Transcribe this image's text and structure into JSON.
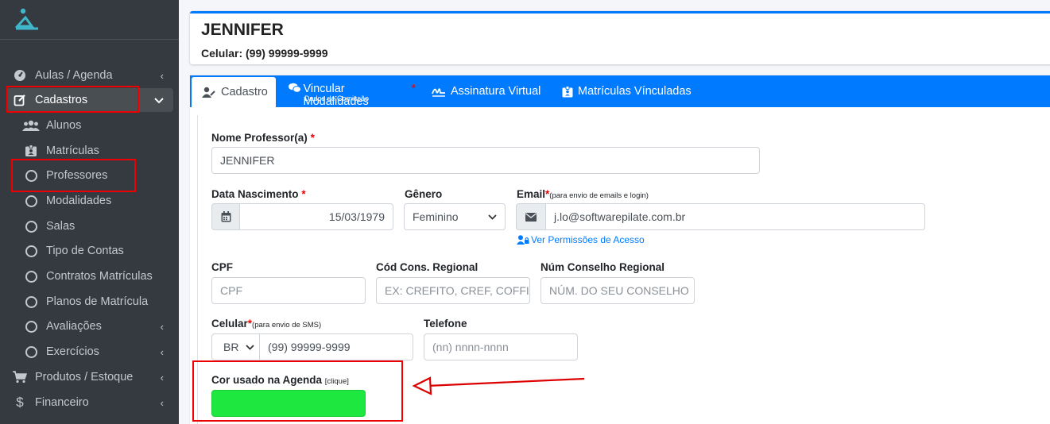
{
  "sidebar": {
    "items": [
      {
        "label": "Aulas / Agenda",
        "icon": "dashboard-icon",
        "chevron": "‹"
      },
      {
        "label": "Cadastros",
        "icon": "edit-icon",
        "chevron": "⌄"
      },
      {
        "label": "Alunos",
        "icon": "users-icon"
      },
      {
        "label": "Matrículas",
        "icon": "id-badge-icon"
      },
      {
        "label": "Professores",
        "icon": "circle-icon"
      },
      {
        "label": "Modalidades",
        "icon": "circle-icon"
      },
      {
        "label": "Salas",
        "icon": "circle-icon"
      },
      {
        "label": "Tipo de Contas",
        "icon": "circle-icon"
      },
      {
        "label": "Contratos Matrículas",
        "icon": "circle-icon"
      },
      {
        "label": "Planos de Matrícula",
        "icon": "circle-icon"
      },
      {
        "label": "Avaliações",
        "icon": "circle-icon",
        "chevron": "‹"
      },
      {
        "label": "Exercícios",
        "icon": "circle-icon",
        "chevron": "‹"
      },
      {
        "label": "Produtos / Estoque",
        "icon": "cart-icon",
        "chevron": "‹"
      },
      {
        "label": "Financeiro",
        "icon": "dollar-icon",
        "chevron": "‹"
      }
    ]
  },
  "header": {
    "name": "JENNIFER",
    "phone": "Celular: (99) 99999-9999"
  },
  "tabs": [
    {
      "label": "Cadastro"
    },
    {
      "label": "Vincular Modalidades",
      "sub": "Dados de Comissão",
      "required": "*"
    },
    {
      "label": "Assinatura Virtual"
    },
    {
      "label": "Matrículas Vínculadas"
    }
  ],
  "form": {
    "nome_label": "Nome Professor(a)",
    "nome_value": "JENNIFER",
    "data_label": "Data Nascimento",
    "data_value": "15/03/1979",
    "genero_label": "Gênero",
    "genero_value": "Feminino",
    "email_label": "Email",
    "email_note": "(para envio de emails e login)",
    "email_value": "j.lo@softwarepilate.com.br",
    "permissoes_link": "Ver Permissões de Acesso",
    "cpf_label": "CPF",
    "cpf_placeholder": "CPF",
    "cod_label": "Cód Cons. Regional",
    "cod_placeholder": "EX: CREFITO, CREF, COFFITO",
    "num_label": "Núm Conselho Regional",
    "num_placeholder": "NÚM. DO SEU CONSELHO",
    "celular_label": "Celular",
    "celular_note": "(para envio de SMS)",
    "country_value": "BR",
    "celular_value": "(99) 99999-9999",
    "telefone_label": "Telefone",
    "telefone_placeholder": "(nn) nnnn-nnnn",
    "cor_label": "Cor usado na Agenda",
    "cor_note": "[clique]",
    "cor_value": "#1ee83f",
    "required_mark": "*"
  },
  "colors": {
    "primary": "#007bff",
    "sidebar_bg": "#343a40",
    "highlight": "#e00000",
    "agenda_color": "#1ee83f"
  }
}
